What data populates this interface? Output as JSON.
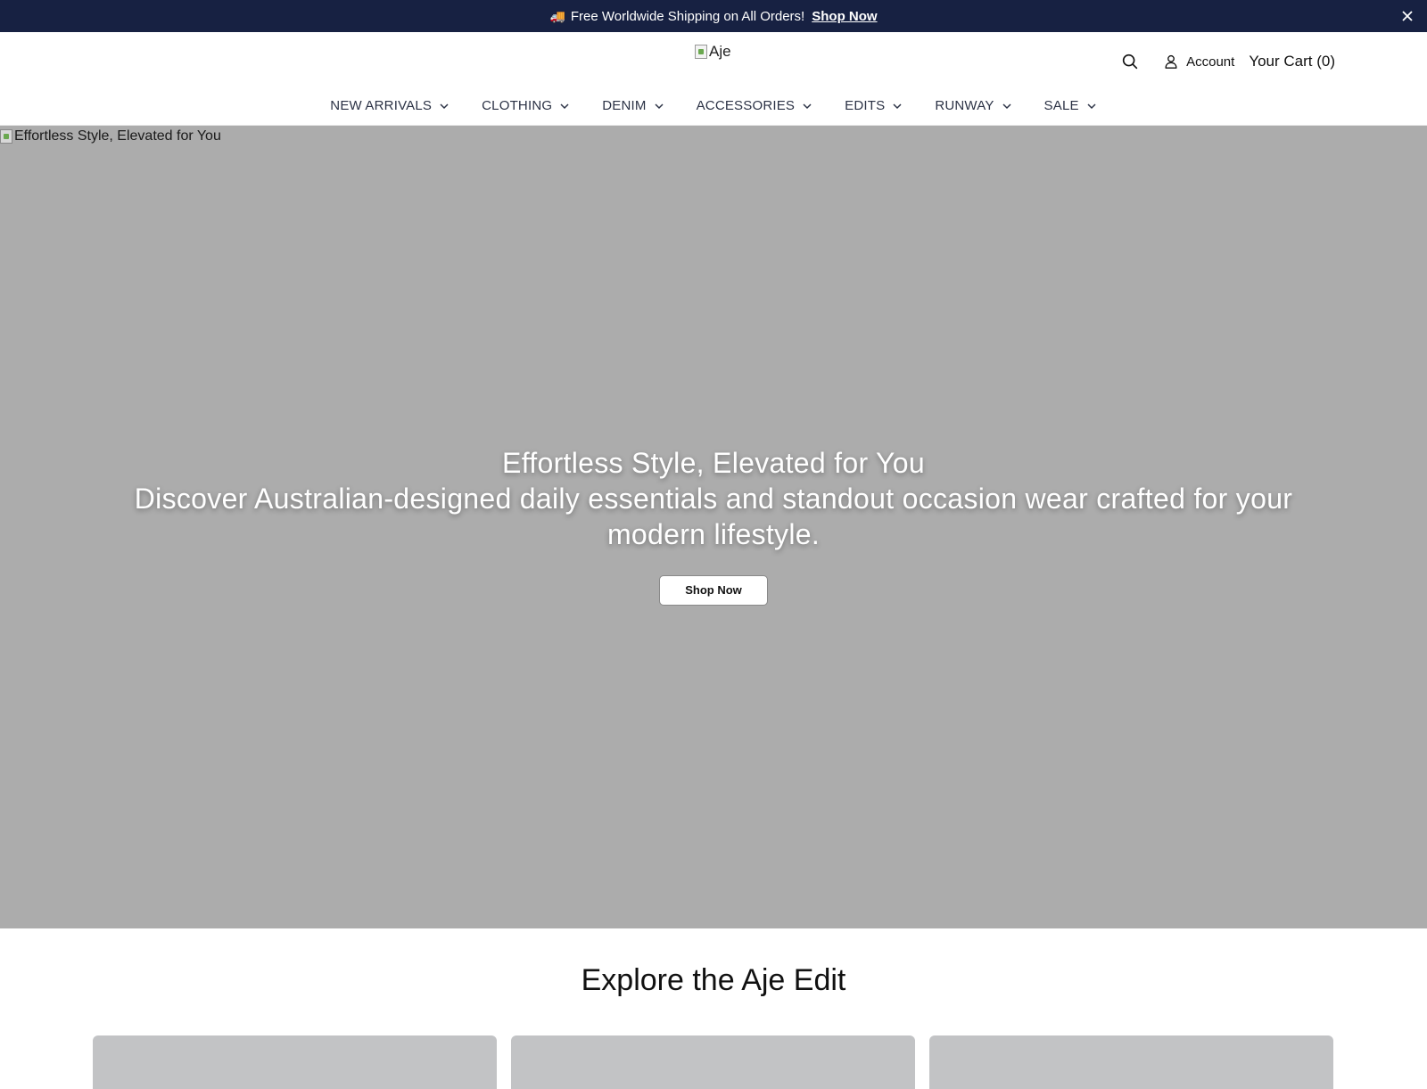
{
  "announcement": {
    "icon": "truck-icon",
    "text": "Free Worldwide Shipping on All Orders!",
    "link": "Shop Now"
  },
  "header": {
    "logo_alt": "Aje",
    "account_label": "Account",
    "cart_label": "Your Cart (0)"
  },
  "nav": {
    "items": [
      {
        "label": "NEW ARRIVALS"
      },
      {
        "label": "CLOTHING"
      },
      {
        "label": "DENIM"
      },
      {
        "label": "ACCESSORIES"
      },
      {
        "label": "EDITS"
      },
      {
        "label": "RUNWAY"
      },
      {
        "label": "SALE"
      }
    ]
  },
  "hero": {
    "image_alt": "Effortless Style, Elevated for You",
    "title": "Effortless Style, Elevated for You",
    "subtitle": "Discover Australian-designed daily essentials and standout occasion wear crafted for your modern lifestyle.",
    "button_label": "Shop Now"
  },
  "explore": {
    "title": "Explore the Aje Edit"
  },
  "colors": {
    "announcement_bg": "#172142",
    "hero_bg": "#acacac",
    "card_bg": "#c2c3c5"
  }
}
